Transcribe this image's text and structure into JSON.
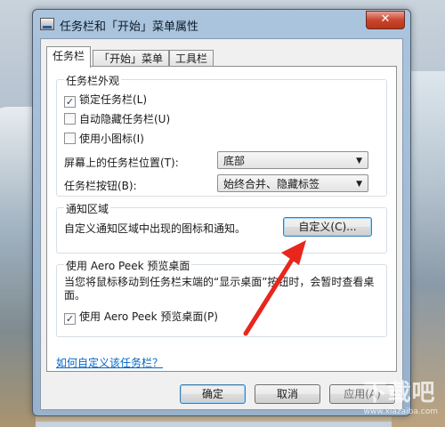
{
  "window": {
    "title": "任务栏和「开始」菜单属性",
    "close_label": "✕"
  },
  "tabs": [
    {
      "label": "任务栏"
    },
    {
      "label": "「开始」菜单"
    },
    {
      "label": "工具栏"
    }
  ],
  "appearance": {
    "group_title": "任务栏外观",
    "lock_taskbar": {
      "label": "锁定任务栏(L)",
      "checked": true
    },
    "auto_hide": {
      "label": "自动隐藏任务栏(U)",
      "checked": false
    },
    "small_icons": {
      "label": "使用小图标(I)",
      "checked": false
    },
    "location_label": "屏幕上的任务栏位置(T):",
    "location_value": "底部",
    "buttons_label": "任务栏按钮(B):",
    "buttons_value": "始终合并、隐藏标签"
  },
  "notification": {
    "group_title": "通知区域",
    "description": "自定义通知区域中出现的图标和通知。",
    "customize_button": "自定义(C)..."
  },
  "aero_peek": {
    "group_title": "使用 Aero Peek 预览桌面",
    "description": "当您将鼠标移动到任务栏末端的“显示桌面”按钮时，会暂时查看桌面。",
    "checkbox": {
      "label": "使用 Aero Peek 预览桌面(P)",
      "checked": true
    }
  },
  "help_link": "如何自定义该任务栏？",
  "footer": {
    "ok": "确定",
    "cancel": "取消",
    "apply": "应用(A)"
  },
  "watermark": {
    "main": "下载吧",
    "sub": "www.xiazaiba.com"
  },
  "colors": {
    "annotation_arrow": "#e8261c",
    "link": "#0066cc"
  }
}
